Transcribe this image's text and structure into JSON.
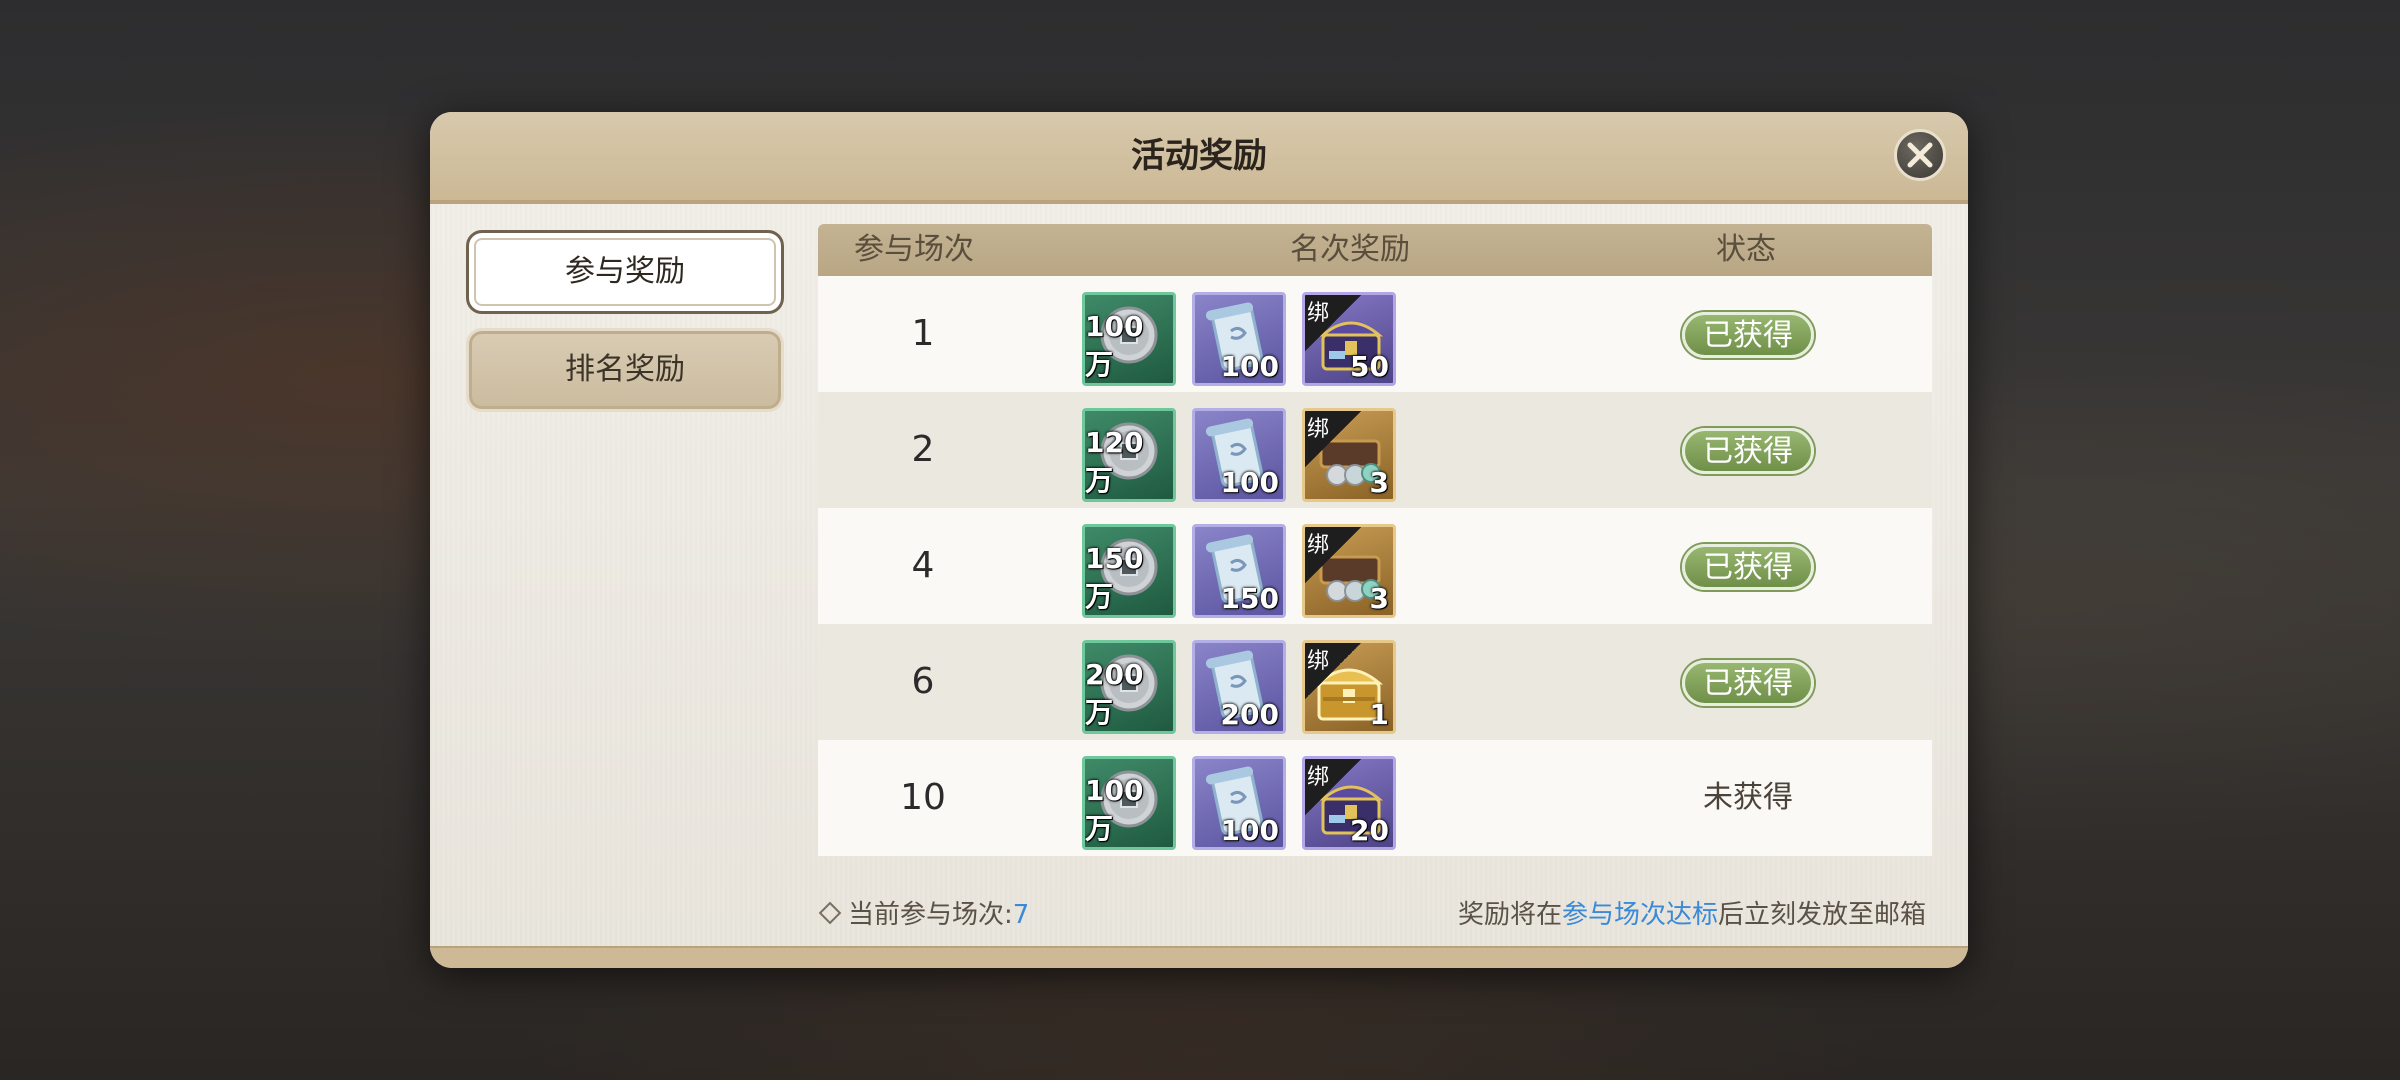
{
  "dialog": {
    "title": "活动奖励",
    "close_icon": "close-icon"
  },
  "tabs": [
    {
      "label": "参与奖励",
      "active": true
    },
    {
      "label": "排名奖励",
      "active": false
    }
  ],
  "table": {
    "headers": [
      "参与场次",
      "名次奖励",
      "状态"
    ],
    "rows": [
      {
        "count": "1",
        "rewards": [
          {
            "icon": "coin-icon",
            "qty": "100万"
          },
          {
            "icon": "scroll-icon",
            "qty": "100"
          },
          {
            "icon": "purple-chest-icon",
            "qty": "50",
            "bind": "绑"
          }
        ],
        "status": "已获得",
        "claimed": true
      },
      {
        "count": "2",
        "rewards": [
          {
            "icon": "coin-icon",
            "qty": "120万"
          },
          {
            "icon": "scroll-icon",
            "qty": "100"
          },
          {
            "icon": "jade-chest-icon",
            "qty": "3",
            "bind": "绑"
          }
        ],
        "status": "已获得",
        "claimed": true
      },
      {
        "count": "4",
        "rewards": [
          {
            "icon": "coin-icon",
            "qty": "150万"
          },
          {
            "icon": "scroll-icon",
            "qty": "150"
          },
          {
            "icon": "jade-chest-icon",
            "qty": "3",
            "bind": "绑"
          }
        ],
        "status": "已获得",
        "claimed": true
      },
      {
        "count": "6",
        "rewards": [
          {
            "icon": "coin-icon",
            "qty": "200万"
          },
          {
            "icon": "scroll-icon",
            "qty": "200"
          },
          {
            "icon": "gold-chest-icon",
            "qty": "1",
            "bind": "绑"
          }
        ],
        "status": "已获得",
        "claimed": true
      },
      {
        "count": "10",
        "rewards": [
          {
            "icon": "coin-icon",
            "qty": "100万"
          },
          {
            "icon": "scroll-icon",
            "qty": "100"
          },
          {
            "icon": "purple-chest-icon",
            "qty": "20",
            "bind": "绑"
          }
        ],
        "status": "未获得",
        "claimed": false
      }
    ]
  },
  "footer": {
    "current_label": "当前参与场次:",
    "current_value": "7",
    "note_prefix": "奖励将在",
    "note_highlight": "参与场次达标",
    "note_suffix": "后立刻发放至邮箱"
  },
  "colors": {
    "title_bar": "#cbb895",
    "status_green": "#7a9a55",
    "highlight_blue": "#3a8ad8"
  }
}
